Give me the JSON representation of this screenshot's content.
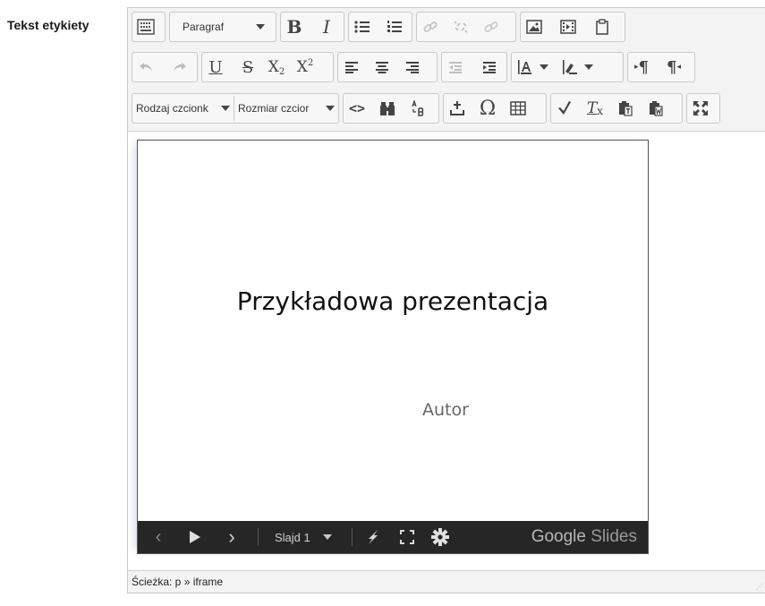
{
  "field": {
    "label": "Tekst etykiety"
  },
  "toolbar": {
    "paragraph_format": "Paragraf",
    "font_family": "Rodzaj czcionk",
    "font_size": "Rozmiar czcior",
    "bold": "B",
    "italic": "I",
    "underline": "U",
    "strike": "S",
    "subscript": "X",
    "subscript_mark": "2",
    "superscript": "X",
    "superscript_mark": "2",
    "special_char": "Ω",
    "code": "<>",
    "ltr": "¶",
    "rtl": "¶"
  },
  "slides": {
    "title": "Przykładowa prezentacja",
    "subtitle": "Autor",
    "player": {
      "slide_label": "Slajd 1",
      "brand_google": "Google",
      "brand_slides": "Slides"
    }
  },
  "statusbar": {
    "path": "Ścieżka: p » iframe"
  },
  "colors": {
    "toolbar_bg": "#f3f3f3",
    "player_bg": "#262626",
    "border": "#c9c9c9"
  }
}
